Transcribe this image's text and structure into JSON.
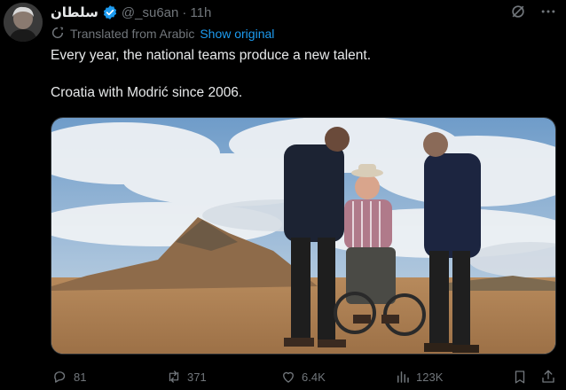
{
  "author": {
    "display_name": "سلطان",
    "handle": "@_su6an",
    "separator": "·",
    "time": "11h",
    "avatar_icon": "person-avatar",
    "verified_icon": "verified-badge-icon"
  },
  "translation": {
    "label": "Translated from Arabic",
    "show_original_label": "Show original"
  },
  "tweet": {
    "line1": "Every year, the national teams produce a new talent.",
    "line2": "Croatia with Modrić since 2006."
  },
  "actions": {
    "replies": "81",
    "reposts": "371",
    "likes": "6.4K",
    "views": "123K"
  },
  "colors": {
    "background": "#000000",
    "text": "#e7e9ea",
    "muted": "#71767b",
    "link": "#1d9bf0"
  }
}
